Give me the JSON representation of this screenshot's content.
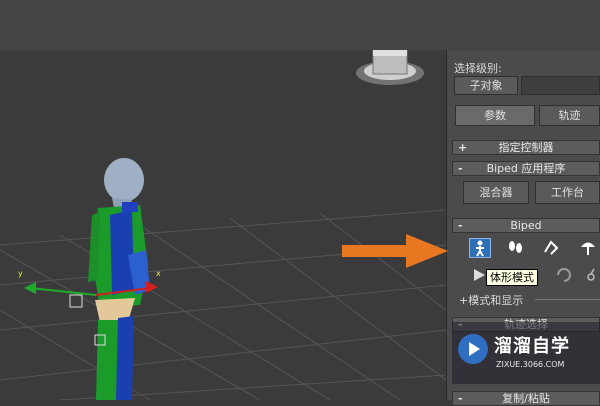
{
  "panel": {
    "selection_level_label": "选择级别:",
    "sub_object_button": "子对象",
    "tabs": [
      {
        "label": "参数",
        "selected": true
      },
      {
        "label": "轨迹",
        "selected": false
      }
    ],
    "rollouts": {
      "assign_controller": {
        "sign": "+",
        "title": "指定控制器"
      },
      "biped_apps": {
        "sign": "-",
        "title": "Biped 应用程序"
      },
      "biped": {
        "sign": "-",
        "title": "Biped"
      },
      "trajectory_select": {
        "sign": "-",
        "title": "轨迹选择"
      },
      "copy_paste": {
        "sign": "-",
        "title": "复制/粘贴"
      }
    },
    "mixer_button": "混合器",
    "workbench_button": "工作台",
    "mode_display_label": "+模式和显示"
  },
  "tooltip": {
    "text": "体形模式"
  },
  "watermark": {
    "title": "溜溜自学",
    "subtitle": "ZIXUE.3066.COM"
  },
  "colors": {
    "accent_arrow": "#e87722",
    "active_icon": "#2e6fb5"
  },
  "icons": {
    "figure_mode": "figure-mode-icon",
    "footstep_mode": "footstep-mode-icon",
    "motion_flow": "motion-flow-icon",
    "mixer_mode": "mixer-mode-icon"
  }
}
